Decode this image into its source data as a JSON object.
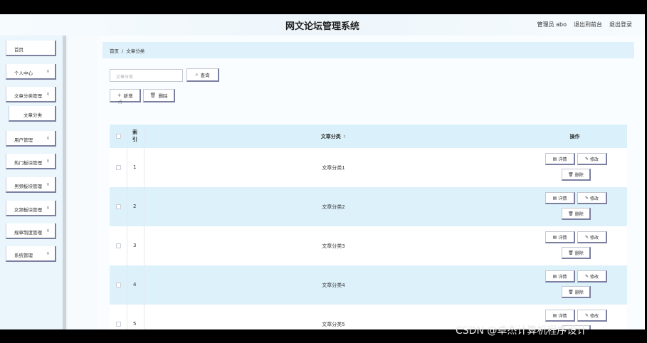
{
  "header": {
    "title": "网文论坛管理系统",
    "user_label": "管理员 abo",
    "back_to_front": "退出到前台",
    "logout": "退出登录"
  },
  "sidebar": {
    "items": [
      {
        "label": "首页",
        "has_chevron": false
      },
      {
        "label": "个人中心",
        "has_chevron": true
      },
      {
        "label": "文章分类管理",
        "has_chevron": true
      },
      {
        "label": "文章分类",
        "has_chevron": false
      },
      {
        "label": "用户管理",
        "has_chevron": true
      },
      {
        "label": "热门板块管理",
        "has_chevron": true
      },
      {
        "label": "男频板块管理",
        "has_chevron": true
      },
      {
        "label": "女频板块管理",
        "has_chevron": true
      },
      {
        "label": "规章制度管理",
        "has_chevron": true
      },
      {
        "label": "系统管理",
        "has_chevron": true
      }
    ]
  },
  "breadcrumb": {
    "home": "首页",
    "separator": "/",
    "current": "文章分类"
  },
  "search": {
    "placeholder": "文章分类",
    "button_label": "查询"
  },
  "toolbar": {
    "add_label": "新增",
    "delete_label": "删除"
  },
  "table": {
    "headers": {
      "index": "索引",
      "category": "文章分类",
      "sort_icon": "⇕",
      "actions": "操作"
    },
    "rows": [
      {
        "index": "1",
        "category": "文章分类1"
      },
      {
        "index": "2",
        "category": "文章分类2"
      },
      {
        "index": "3",
        "category": "文章分类3"
      },
      {
        "index": "4",
        "category": "文章分类4"
      },
      {
        "index": "5",
        "category": "文章分类5"
      }
    ],
    "row_actions": {
      "detail": "详情",
      "edit": "修改",
      "delete": "删除"
    }
  },
  "watermark": "CSDN @卓杰计算机程序设计",
  "colors": {
    "accent_border": "#7b80a0",
    "header_bg": "#daf1fb",
    "alt_row_bg": "#ddf1fb",
    "sidebar_bg": "#eaf5fc"
  }
}
